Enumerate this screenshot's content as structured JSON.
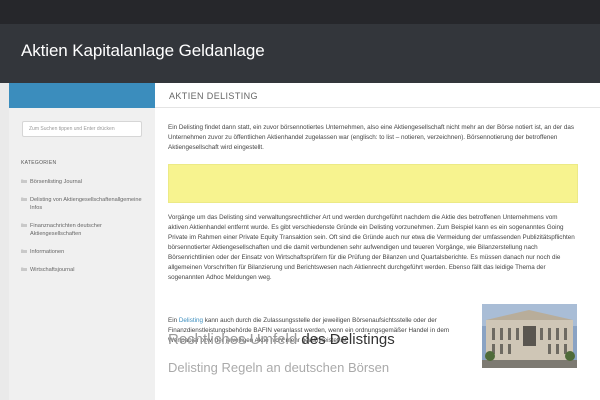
{
  "site": {
    "title": "Aktien Kapitalanlage Geldanlage"
  },
  "page": {
    "heading": "AKTIEN DELISTING"
  },
  "sidebar": {
    "search_placeholder": "Zum Suchen tippen und Enter drücken",
    "categories_heading": "KATEGORIEN",
    "categories": [
      {
        "label": "Börsenlisting Journal"
      },
      {
        "label": "Delisting von Aktiengesellschaftenallgemeine Infos"
      },
      {
        "label": "Finanznachrichten deutscher Aktiengesellschaften"
      },
      {
        "label": "Informationen"
      },
      {
        "label": "Wirtschaftsjournal"
      }
    ]
  },
  "article": {
    "paragraph1": "Ein Delisting findet dann statt, ein zuvor börsennotiertes Unternehmen, also eine Aktiengesellschaft nicht mehr an der Börse notiert ist, an der das Unternehmen zuvor zu öffentlichen Aktienhandel zugelassen war (englisch: to list – notieren, verzeichnen). Börsennotierung der betroffenen Aktiengesellschaft wird eingestellt.",
    "paragraph2": "Vorgänge um das Delisting sind verwaltungsrechtlicher Art und werden durchgeführt nachdem die Aktie des betroffenen Unternehmens vom aktiven Aktienhandel entfernt wurde. Es gibt verschiedenste Gründe ein Delisting vorzunehmen. Zum Beispiel kann es ein sogenanntes Going Private im Rahmen einer Private Equity Transaktion sein. Oft sind die Gründe auch nur etwa die Vermeidung der umfassenden Publizitätspflichten börsennotierter Aktiengesellschaften und die damit verbundenen sehr aufwendigen und teueren Vorgänge, wie Bilanzerstellung nach Börsenrichtlinien oder der Einsatz von Wirtschaftsprüfern für die Prüfung der Bilanzen und Quartalsberichte. Es müssen danach nur noch die allgemeinen Vorschriften für Bilanzierung und Berichtswesen nach Aktienrecht durchgeführt werden. Ebenso fällt das leidige Thema der sogenannten Adhoc Meldungen weg.",
    "paragraph3_prefix": "Ein ",
    "paragraph3_link": "Delisting",
    "paragraph3_rest": " kann auch durch die Zulassungsstelle der jeweiligen Börsenaufsichtsstelle oder der Finanzdienstleistungsbehörde BAFIN veranlasst werden, wenn ein ordnungsgemäßer Handel in dem Wertpapier bzw. der jeweiligen Aktie nicht mehr gewährleistet ist.",
    "subheading_light": "Rechtliches Umfeld ",
    "subheading_strong": "des Delistings",
    "subheading2": "Delisting Regeln an deutschen Börsen"
  },
  "colors": {
    "accent": "#3b8dbd",
    "header_bg": "#33363b",
    "topbar_bg": "#26272b",
    "highlight_box": "#f7f38f"
  },
  "icons": {
    "category": "folder-icon"
  }
}
